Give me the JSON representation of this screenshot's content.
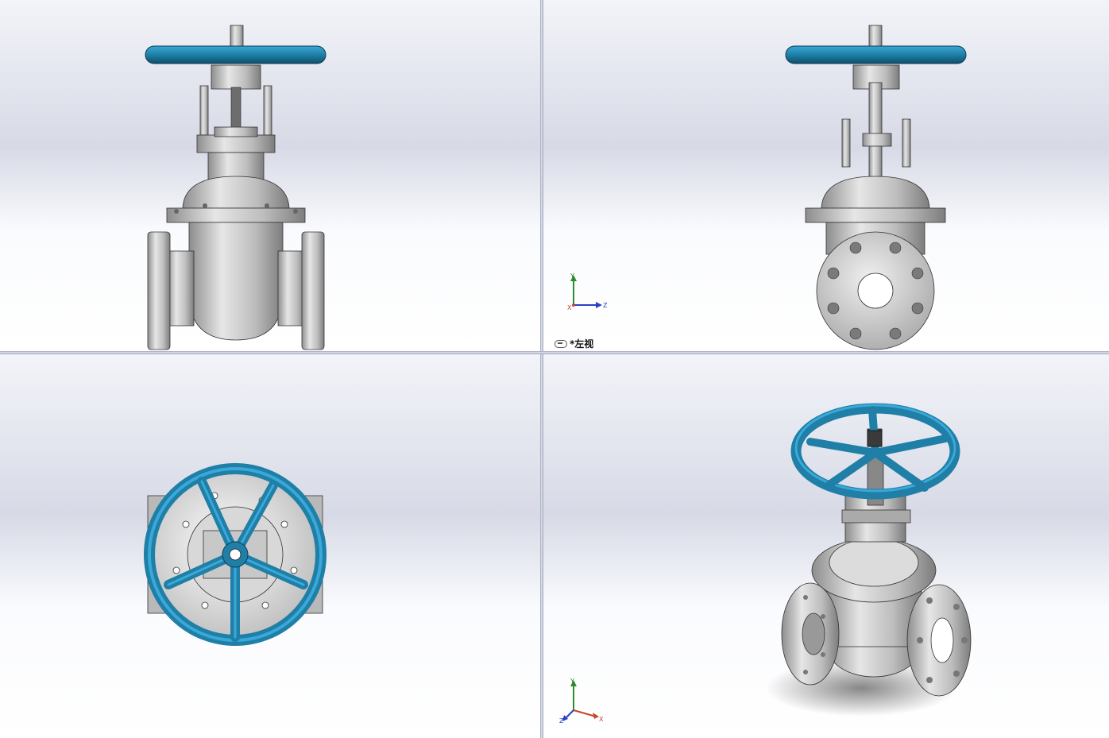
{
  "window": {
    "layout": "four-viewport"
  },
  "viewports": {
    "top_right": {
      "label": "*左视",
      "triad_axes": [
        "Y",
        "X",
        "Z"
      ]
    },
    "bottom_right": {
      "triad_axes": [
        "Y",
        "Z",
        "X"
      ]
    }
  },
  "colors": {
    "handwheel": "#1f7fa6",
    "handwheel_light": "#3aa8d8",
    "metal": "#c4c4c4",
    "metal_dark": "#8a8a8a",
    "axis_y": "#2e8b2e",
    "axis_z": "#2a3fc4",
    "axis_x": "#c8452a"
  }
}
